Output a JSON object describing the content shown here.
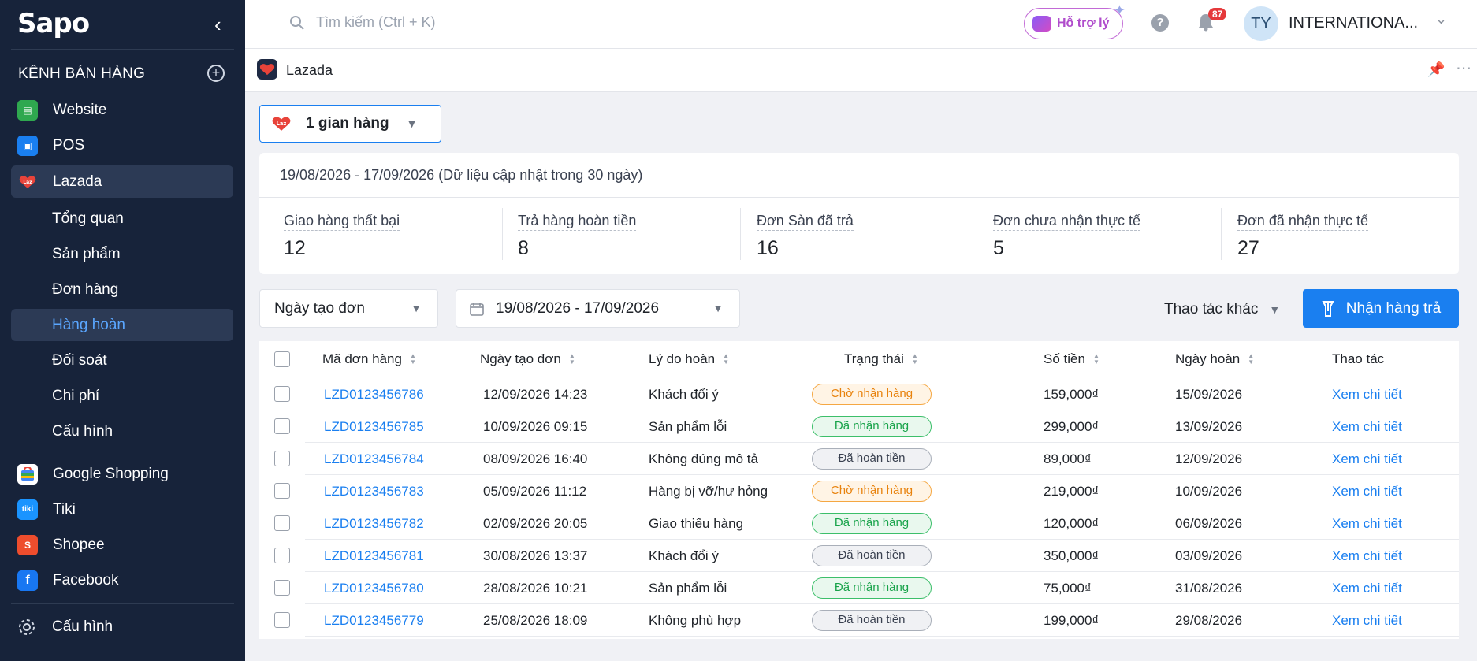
{
  "sidebar": {
    "logo": "Sapo",
    "section_title": "KÊNH BÁN HÀNG",
    "channels": [
      {
        "label": "Website",
        "icon": "website-icon",
        "color": "#2fa84f"
      },
      {
        "label": "POS",
        "icon": "pos-icon",
        "color": "#1a7ff0"
      },
      {
        "label": "Lazada",
        "icon": "lazada-icon",
        "color": "#1e2a44",
        "active": true
      }
    ],
    "lazada_sub": [
      "Tổng quan",
      "Sản phẩm",
      "Đơn hàng",
      "Hàng hoàn",
      "Đối soát",
      "Chi phí",
      "Cấu hình"
    ],
    "other_channels": [
      {
        "label": "Google Shopping",
        "icon": "google-shopping-icon"
      },
      {
        "label": "Tiki",
        "icon": "tiki-icon",
        "color": "#1a94ff"
      },
      {
        "label": "Shopee",
        "icon": "shopee-icon",
        "color": "#ee4d2d"
      },
      {
        "label": "Facebook",
        "icon": "facebook-icon",
        "color": "#1877f2"
      }
    ],
    "bottom_label": "Cấu hình"
  },
  "topbar": {
    "search_placeholder": "Tìm kiếm (Ctrl + K)",
    "support_label": "Hỗ trợ lý",
    "notif_count": "87",
    "avatar_initials": "TY",
    "user_name": "INTERNATIONA..."
  },
  "page": {
    "title": "Lazada",
    "store_selector": "1 gian hàng",
    "date_range_note": "19/08/2026 - 17/09/2026 (Dữ liệu cập nhật trong 30 ngày)",
    "stats": [
      {
        "label": "Giao hàng thất bại",
        "value": "12"
      },
      {
        "label": "Trả hàng hoàn tiền",
        "value": "8"
      },
      {
        "label": "Đơn Sàn đã trả",
        "value": "16"
      },
      {
        "label": "Đơn chưa nhận thực tế",
        "value": "5"
      },
      {
        "label": "Đơn đã nhận thực tế",
        "value": "27"
      }
    ],
    "filter_date_type": "Ngày tạo đơn",
    "filter_date_range": "19/08/2026 - 17/09/2026",
    "other_actions": "Thao tác khác",
    "primary_action": "Nhận hàng trả"
  },
  "table": {
    "columns": [
      "Mã đơn hàng",
      "Ngày tạo đơn",
      "Lý do hoàn",
      "Trạng thái",
      "Số tiền",
      "Ngày hoàn",
      "Thao tác"
    ],
    "rows": [
      {
        "id": "LZD0123456786",
        "created": "12/09/2026 14:23",
        "reason": "Khách đổi ý",
        "status": "Chờ nhận hàng",
        "amount": "159,000₫",
        "returned": "15/09/2026",
        "action": "Xem chi tiết"
      },
      {
        "id": "LZD0123456785",
        "created": "10/09/2026 09:15",
        "reason": "Sản phẩm lỗi",
        "status": "Đã nhận hàng",
        "amount": "299,000₫",
        "returned": "13/09/2026",
        "action": "Xem chi tiết"
      },
      {
        "id": "LZD0123456784",
        "created": "08/09/2026 16:40",
        "reason": "Không đúng mô tả",
        "status": "Đã hoàn tiền",
        "amount": "89,000₫",
        "returned": "12/09/2026",
        "action": "Xem chi tiết"
      },
      {
        "id": "LZD0123456783",
        "created": "05/09/2026 11:12",
        "reason": "Hàng bị vỡ/hư hỏng",
        "status": "Chờ nhận hàng",
        "amount": "219,000₫",
        "returned": "10/09/2026",
        "action": "Xem chi tiết"
      },
      {
        "id": "LZD0123456782",
        "created": "02/09/2026 20:05",
        "reason": "Giao thiếu hàng",
        "status": "Đã nhận hàng",
        "amount": "120,000₫",
        "returned": "06/09/2026",
        "action": "Xem chi tiết"
      },
      {
        "id": "LZD0123456781",
        "created": "30/08/2026 13:37",
        "reason": "Khách đổi ý",
        "status": "Đã hoàn tiền",
        "amount": "350,000₫",
        "returned": "03/09/2026",
        "action": "Xem chi tiết"
      },
      {
        "id": "LZD0123456780",
        "created": "28/08/2026 10:21",
        "reason": "Sản phẩm lỗi",
        "status": "Đã nhận hàng",
        "amount": "75,000₫",
        "returned": "31/08/2026",
        "action": "Xem chi tiết"
      },
      {
        "id": "LZD0123456779",
        "created": "25/08/2026 18:09",
        "reason": "Không phù hợp",
        "status": "Đã hoàn tiền",
        "amount": "199,000₫",
        "returned": "29/08/2026",
        "action": "Xem chi tiết"
      }
    ]
  },
  "status_colors": {
    "Chờ nhận hàng": {
      "fg": "#e8820c",
      "bg": "#fff4e5",
      "border": "#f5a742"
    },
    "Đã nhận hàng": {
      "fg": "#18a34a",
      "bg": "#e9f8ee",
      "border": "#3cbf6a"
    },
    "Đã hoàn tiền": {
      "fg": "#3a4150",
      "bg": "#f0f1f4",
      "border": "#a9afb9"
    }
  }
}
